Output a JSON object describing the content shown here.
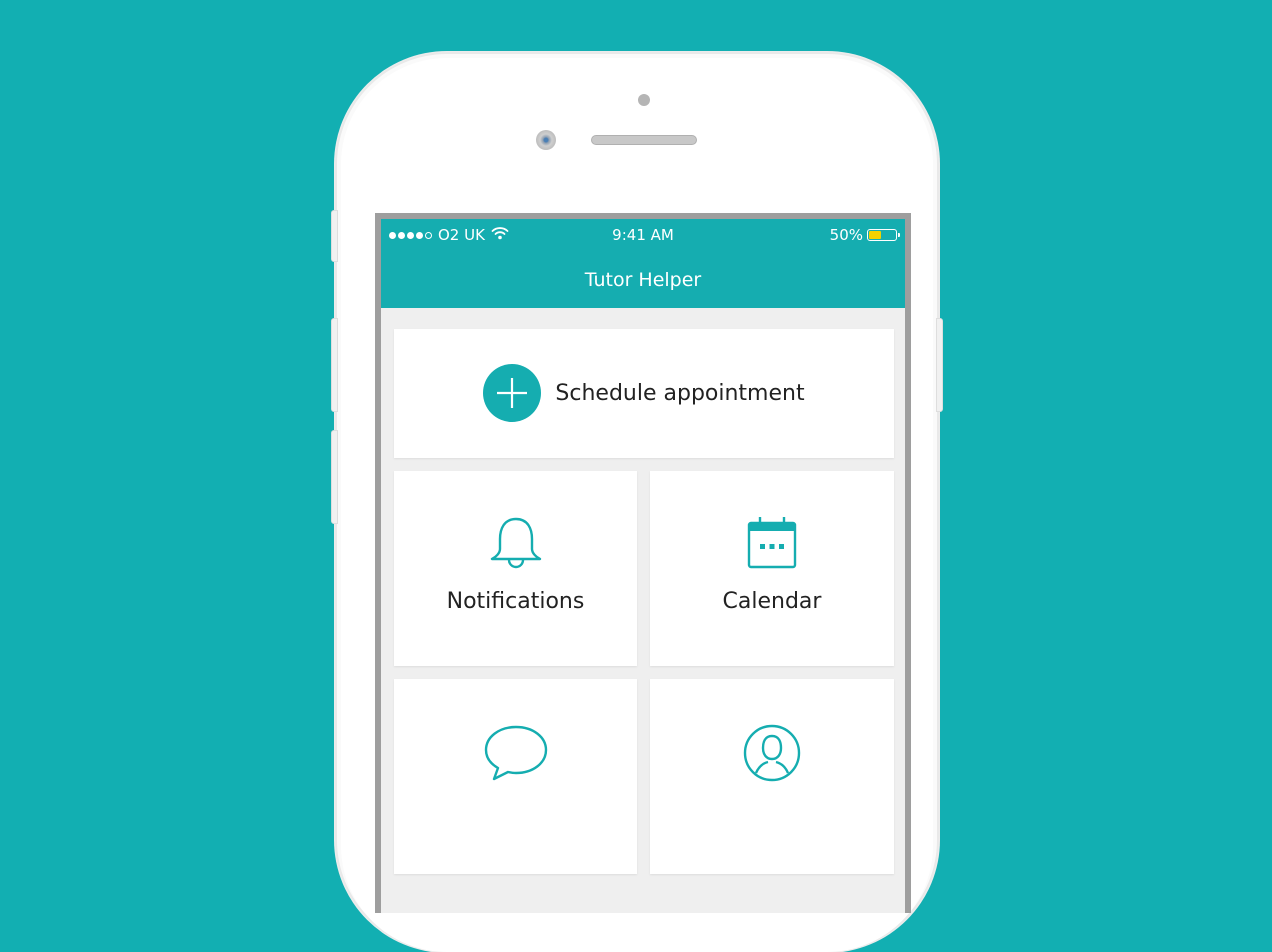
{
  "status_bar": {
    "carrier": "O2 UK",
    "time": "9:41 AM",
    "battery_percent": "50%",
    "battery_level": 0.5,
    "signal_bars": 4,
    "signal_max": 5
  },
  "header": {
    "title": "Tutor Helper"
  },
  "actions": {
    "schedule_label": "Schedule appointment",
    "tiles": [
      {
        "label": "Notifications",
        "icon": "bell-icon"
      },
      {
        "label": "Calendar",
        "icon": "calendar-icon"
      },
      {
        "label": "",
        "icon": "chat-bubble-icon"
      },
      {
        "label": "",
        "icon": "user-profile-icon"
      }
    ]
  },
  "colors": {
    "accent": "#15adb0",
    "background": "#12afb2",
    "battery_fill": "#f2d200"
  }
}
